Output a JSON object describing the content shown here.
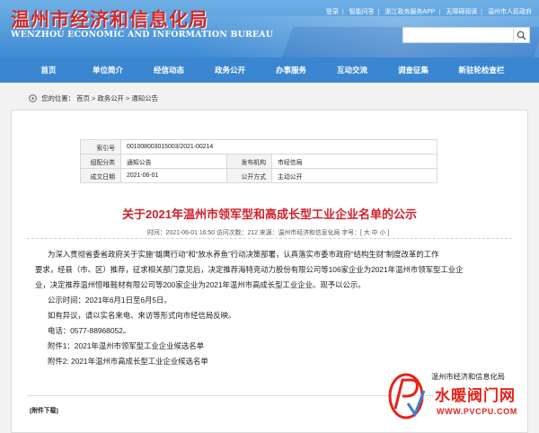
{
  "header": {
    "title_cn": "温州市经济和信息化局",
    "title_en": "WENZHOU ECONOMIC AND INFORMATION BUREAU",
    "links": [
      "登录",
      "智能问答",
      "浙江政务服务APP",
      "无障碍阅读",
      "温州市人民政府"
    ],
    "search_placeholder": ""
  },
  "nav": {
    "items": [
      "首页",
      "单位简介",
      "经信动态",
      "政务公开",
      "办事服务",
      "互动交流",
      "调查征集",
      "新驻轮检查栏"
    ]
  },
  "breadcrumb": {
    "current": "您的位置：",
    "items": [
      "首页",
      "政务公开",
      "通知公告"
    ],
    "separator": ">"
  },
  "meta": {
    "rows": [
      {
        "label": "索引号",
        "value": "001008003015003/2021-00214"
      },
      {
        "label": "组配分类",
        "value": "通知公告",
        "label2": "发布机构",
        "value2": "市经信局"
      },
      {
        "label": "成文日期",
        "value": "2021-06-01",
        "label2": "公开方式",
        "value2": "主动公开"
      }
    ]
  },
  "article": {
    "title": "关于2021年温州市领军型和高成长型工业企业名单的公示",
    "info": "时间：2021-06-01 16:50 访问次数：212   来源：温州市经济和信息化局   字号：[ 大 中 小 ]",
    "paragraphs": [
      {
        "text": "为深入贯彻省委省政府关于实施“雄鹰行动”和“放水养鱼”行动决策部署，认真落实市委市政府“结构生财”制度改革的工作",
        "indent": true
      },
      {
        "text": "要求，经县（市、区）推荐，征求相关部门意见后，决定推荐海特克动力股份有限公司等106家企业为2021年温州市领军型工业企",
        "indent": false
      },
      {
        "text": "业，决定推荐温州恒唯鞋材有限公司等200家企业为2021年温州市高成长型工业企业。现予以公示。",
        "indent": false
      },
      {
        "text": "公示时间：2021年6月1日至6月5日。",
        "indent": true
      },
      {
        "text": "如有异议，请以实名来电、来访等形式向市经信局反映。",
        "indent": true
      },
      {
        "text": "电话：0577-88968052。",
        "indent": true
      },
      {
        "text": "附件1：2021年温州市领军型工业企业候选名单",
        "indent": true
      },
      {
        "text": "附件2: 2021年温州市高成长型工业企业候选名单",
        "indent": true
      }
    ],
    "signature": "温州市经济和信息化局",
    "downloads_label": "[附件下载]"
  },
  "watermark": {
    "text": "水暖阀门网",
    "url": "WWW.PVCPU.COM",
    "colors": {
      "brand": "#e1251b"
    }
  },
  "colors": {
    "nav": "#3a86d0",
    "title": "#d0202a",
    "header_top": "#6fb0e6"
  }
}
